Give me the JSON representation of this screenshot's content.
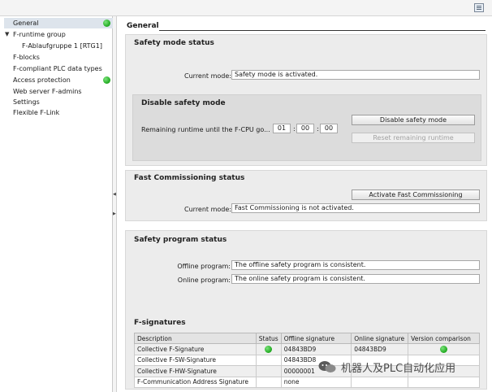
{
  "tree": {
    "items": [
      {
        "label": "General",
        "status": "green"
      },
      {
        "label": "F-runtime group"
      },
      {
        "label": "F-Ablaufgruppe 1 [RTG1]"
      },
      {
        "label": "F-blocks"
      },
      {
        "label": "F-compliant PLC data types"
      },
      {
        "label": "Access protection",
        "status": "green"
      },
      {
        "label": "Web server F-admins"
      },
      {
        "label": "Settings"
      },
      {
        "label": "Flexible F-Link"
      }
    ]
  },
  "general": {
    "title": "General"
  },
  "safety_mode": {
    "title": "Safety mode status",
    "current_mode_label": "Current mode:",
    "current_mode_value": "Safety mode is activated.",
    "disable": {
      "title": "Disable safety mode",
      "remaining_label": "Remaining runtime until the F-CPU go...",
      "hh": "01",
      "mm": "00",
      "ss": "00",
      "sep": ":",
      "disable_button": "Disable safety mode",
      "reset_button": "Reset remaining runtime"
    }
  },
  "fast_commissioning": {
    "title": "Fast Commissioning status",
    "activate_button": "Activate Fast Commissioning",
    "current_mode_label": "Current mode:",
    "current_mode_value": "Fast Commissioning is not activated."
  },
  "safety_program": {
    "title": "Safety program status",
    "offline_label": "Offline program:",
    "offline_value": "The offline safety program is consistent.",
    "online_label": "Online program:",
    "online_value": "The online safety program is consistent."
  },
  "signatures": {
    "title": "F-signatures",
    "headers": [
      "Description",
      "Status",
      "Offline signature",
      "Online signature",
      "Version comparison"
    ],
    "rows": [
      {
        "description": "Collective F-Signature",
        "status": "green",
        "offline": "04843BD9",
        "online": "04843BD9",
        "version": "green"
      },
      {
        "description": "Collective F-SW-Signature",
        "status": "",
        "offline": "04843BD8",
        "online": "",
        "version": ""
      },
      {
        "description": "Collective F-HW-Signature",
        "status": "",
        "offline": "00000001",
        "online": "",
        "version": ""
      },
      {
        "description": "F-Communication Address Signature",
        "status": "",
        "offline": "none",
        "online": "",
        "version": ""
      }
    ]
  },
  "colors": {
    "ok": "#1ea81e"
  },
  "watermark": {
    "text": "机器人及PLC自动化应用"
  }
}
